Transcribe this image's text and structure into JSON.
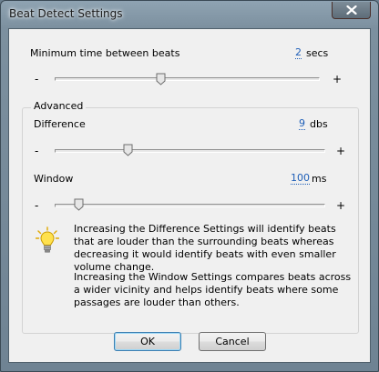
{
  "window": {
    "title": "Beat Detect Settings"
  },
  "min_time": {
    "label": "Minimum time between beats",
    "value": "2",
    "unit": "secs",
    "slider_fraction": 0.4
  },
  "advanced": {
    "legend": "Advanced",
    "difference": {
      "label": "Difference",
      "value": "9",
      "unit": "dbs",
      "slider_fraction": 0.27
    },
    "window": {
      "label": "Window",
      "value": "100",
      "unit": "ms",
      "slider_fraction": 0.09
    },
    "info_1": "Increasing the Difference Settings will identify beats that are louder than the surrounding beats whereas decreasing it would identify beats with even smaller volume change.",
    "info_2": "Increasing the Window Settings compares beats across a wider vicinity and helps identify beats where some passages are louder than others."
  },
  "slider_symbols": {
    "minus": "-",
    "plus": "+"
  },
  "buttons": {
    "ok": "OK",
    "cancel": "Cancel"
  },
  "icons": {
    "close": "close-icon",
    "info": "lightbulb-icon"
  },
  "colors": {
    "value_link": "#1f5fb8"
  }
}
